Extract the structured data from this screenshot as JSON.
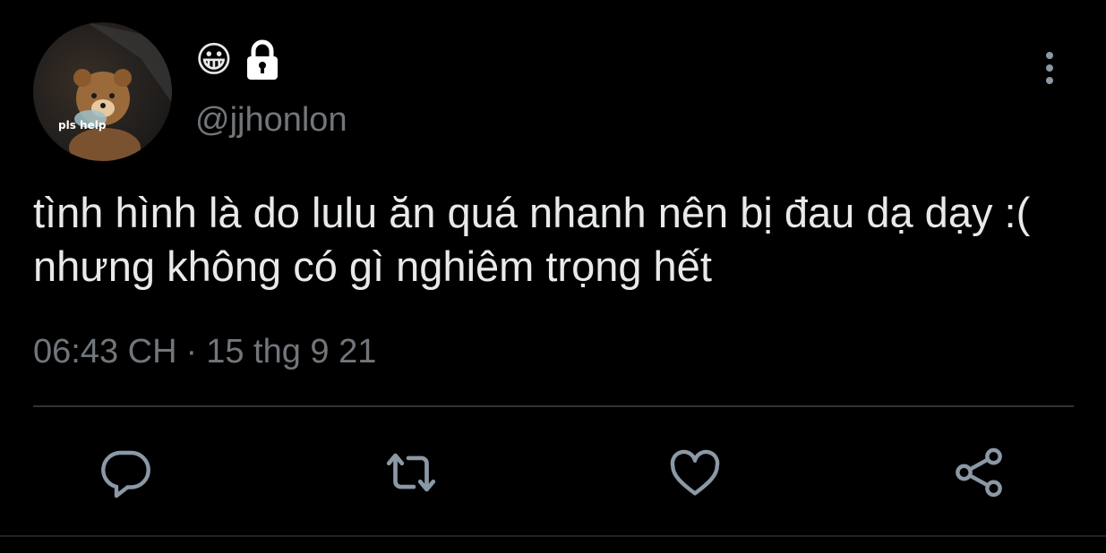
{
  "colors": {
    "background": "#000000",
    "text_primary": "#e7e9ea",
    "text_secondary": "#71767b",
    "icon": "#8b98a5",
    "divider": "#2f3336"
  },
  "user": {
    "avatar_text": "pls help",
    "display_name_emoji": "😀",
    "locked_icon": "lock-icon",
    "handle": "@jjhonlon"
  },
  "tweet": {
    "text": "tình hình là do lulu ăn quá nhanh nên bị đau dạ dạy :( nhưng không có gì nghiêm trọng hết",
    "time": "06:43 CH",
    "separator": "·",
    "date": "15 thg 9 21"
  },
  "actions": [
    {
      "name": "reply",
      "icon": "reply-icon"
    },
    {
      "name": "retweet",
      "icon": "retweet-icon"
    },
    {
      "name": "like",
      "icon": "heart-icon"
    },
    {
      "name": "share",
      "icon": "share-icon"
    }
  ]
}
